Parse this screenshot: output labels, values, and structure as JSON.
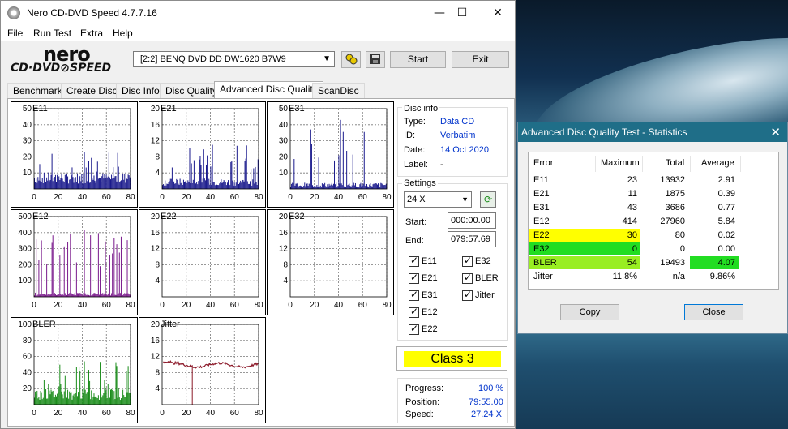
{
  "app": {
    "title": "Nero CD-DVD Speed 4.7.7.16",
    "logo_top": "nero",
    "logo_bottom": "CD·DVD⊘SPEED"
  },
  "window_controls": {
    "minimize": "—",
    "maximize": "☐",
    "close": "✕"
  },
  "menu": [
    "File",
    "Run Test",
    "Extra",
    "Help"
  ],
  "toolbar": {
    "drive": "[2:2]   BENQ DVD DD DW1620 B7W9",
    "start_label": "Start",
    "exit_label": "Exit"
  },
  "tabs": [
    "Benchmark",
    "Create Disc",
    "Disc Info",
    "Disc Quality",
    "Advanced Disc Quality",
    "ScanDisc"
  ],
  "active_tab": "Advanced Disc Quality",
  "disc_info": {
    "header": "Disc info",
    "type_label": "Type:",
    "type": "Data CD",
    "id_label": "ID:",
    "id": "Verbatim",
    "date_label": "Date:",
    "date": "14 Oct 2020",
    "label_label": "Label:",
    "label": "-"
  },
  "settings": {
    "header": "Settings",
    "speed": "24 X",
    "start_label": "Start:",
    "start": "000:00.00",
    "end_label": "End:",
    "end": "079:57.69",
    "checkboxes": [
      "E11",
      "E32",
      "E21",
      "BLER",
      "E31",
      "Jitter",
      "E12",
      "E22"
    ]
  },
  "class": "Class 3",
  "progress": {
    "progress_label": "Progress:",
    "progress": "100 %",
    "position_label": "Position:",
    "position": "79:55.00",
    "speed_label": "Speed:",
    "speed": "27.24 X"
  },
  "chart_data": [
    {
      "type": "bar",
      "title": "E11",
      "xlim": [
        0,
        80
      ],
      "ylim": [
        0,
        50
      ],
      "yticks": [
        10,
        20,
        30,
        40,
        50
      ],
      "xticks": [
        0,
        20,
        40,
        60,
        80
      ],
      "color": "#1a1a8c",
      "base": 8,
      "max": 23
    },
    {
      "type": "bar",
      "title": "E21",
      "xlim": [
        0,
        80
      ],
      "ylim": [
        0,
        20
      ],
      "yticks": [
        4,
        8,
        12,
        16,
        20
      ],
      "xticks": [
        0,
        20,
        40,
        60,
        80
      ],
      "color": "#1a1a8c",
      "base": 2,
      "max": 11
    },
    {
      "type": "bar",
      "title": "E31",
      "xlim": [
        0,
        80
      ],
      "ylim": [
        0,
        50
      ],
      "yticks": [
        10,
        20,
        30,
        40,
        50
      ],
      "xticks": [
        0,
        20,
        40,
        60,
        80
      ],
      "color": "#1a1a8c",
      "base": 3,
      "max": 43
    },
    {
      "type": "bar",
      "title": "E12",
      "xlim": [
        0,
        80
      ],
      "ylim": [
        0,
        500
      ],
      "yticks": [
        100,
        200,
        300,
        400,
        500
      ],
      "xticks": [
        0,
        20,
        40,
        60,
        80
      ],
      "color": "#7a1a8c",
      "base": 20,
      "max": 414
    },
    {
      "type": "bar",
      "title": "E22",
      "xlim": [
        0,
        80
      ],
      "ylim": [
        0,
        20
      ],
      "yticks": [
        4,
        8,
        12,
        16,
        20
      ],
      "xticks": [
        0,
        20,
        40,
        60,
        80
      ],
      "color": "#7a1a8c",
      "base": 0,
      "max": 0
    },
    {
      "type": "bar",
      "title": "E32",
      "xlim": [
        0,
        80
      ],
      "ylim": [
        0,
        20
      ],
      "yticks": [
        4,
        8,
        12,
        16,
        20
      ],
      "xticks": [
        0,
        20,
        40,
        60,
        80
      ],
      "color": "#7a1a8c",
      "base": 0,
      "max": 0
    },
    {
      "type": "bar",
      "title": "BLER",
      "xlim": [
        0,
        80
      ],
      "ylim": [
        0,
        100
      ],
      "yticks": [
        20,
        40,
        60,
        80,
        100
      ],
      "xticks": [
        0,
        20,
        40,
        60,
        80
      ],
      "color": "#1a8c1a",
      "base": 15,
      "max": 54
    },
    {
      "type": "line",
      "title": "Jitter",
      "xlim": [
        0,
        80
      ],
      "ylim": [
        0,
        20
      ],
      "yticks": [
        4,
        8,
        12,
        16,
        20
      ],
      "xticks": [
        0,
        20,
        40,
        60,
        80
      ],
      "color": "#8c1a2a",
      "level": 9.86,
      "max": 11.8
    }
  ],
  "stats_dialog": {
    "title": "Advanced Disc Quality Test - Statistics",
    "headers": [
      "Error",
      "Maximum",
      "Total",
      "Average"
    ],
    "rows": [
      {
        "name": "E11",
        "maximum": "23",
        "total": "13932",
        "average": "2.91",
        "highlight": "",
        "avg_highlight": ""
      },
      {
        "name": "E21",
        "maximum": "11",
        "total": "1875",
        "average": "0.39",
        "highlight": "",
        "avg_highlight": ""
      },
      {
        "name": "E31",
        "maximum": "43",
        "total": "3686",
        "average": "0.77",
        "highlight": "",
        "avg_highlight": ""
      },
      {
        "name": "E12",
        "maximum": "414",
        "total": "27960",
        "average": "5.84",
        "highlight": "",
        "avg_highlight": ""
      },
      {
        "name": "E22",
        "maximum": "30",
        "total": "80",
        "average": "0.02",
        "highlight": "#ffff00",
        "avg_highlight": ""
      },
      {
        "name": "E32",
        "maximum": "0",
        "total": "0",
        "average": "0.00",
        "highlight": "#22dd22",
        "avg_highlight": ""
      },
      {
        "name": "BLER",
        "maximum": "54",
        "total": "19493",
        "average": "4.07",
        "highlight": "#99ee22",
        "avg_highlight": "#22dd22"
      },
      {
        "name": "Jitter",
        "maximum": "11.8%",
        "total": "n/a",
        "average": "9.86%",
        "highlight": "",
        "avg_highlight": ""
      }
    ],
    "copy_label": "Copy",
    "close_label": "Close"
  }
}
